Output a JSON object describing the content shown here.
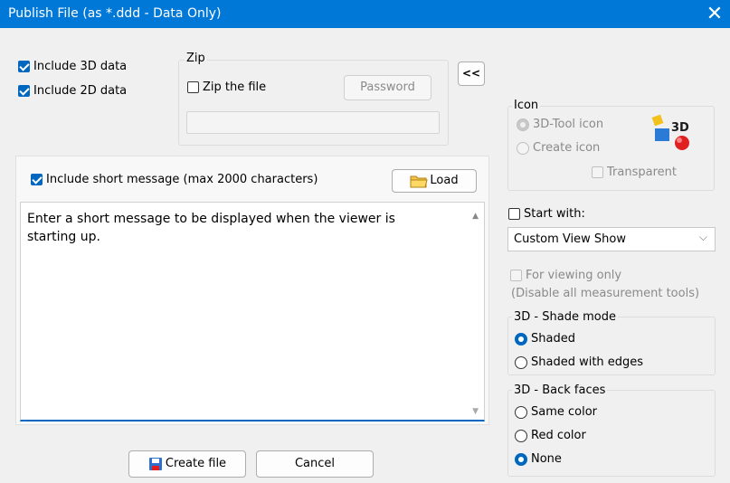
{
  "window": {
    "title": "Publish File (as *.ddd - Data Only)"
  },
  "options": {
    "include_3d": "Include 3D data",
    "include_2d": "Include 2D data"
  },
  "zip": {
    "group_title": "Zip",
    "zip_label": "Zip the file",
    "password_label": "Password"
  },
  "collapse_label": "<<",
  "message": {
    "include_label": "Include short message (max 2000 characters)",
    "load_label": "Load",
    "text": "Enter a short message to be displayed when the viewer is starting up."
  },
  "icon": {
    "group_title": "Icon",
    "tool_icon": "3D-Tool icon",
    "create_icon": "Create icon",
    "transparent": "Transparent",
    "badge": "3D"
  },
  "start": {
    "label": "Start with:",
    "selected": "Custom View Show"
  },
  "viewing": {
    "label": "For viewing only",
    "sublabel": "(Disable all measurement tools)"
  },
  "shade_mode": {
    "title": "3D - Shade mode",
    "options": [
      "Shaded",
      "Shaded with edges"
    ]
  },
  "back_faces": {
    "title": "3D - Back faces",
    "options": [
      "Same color",
      "Red color",
      "None"
    ]
  },
  "footer": {
    "create": "Create file",
    "cancel": "Cancel"
  },
  "colors": {
    "titlebar": "#0078d7",
    "accent": "#0067c0"
  }
}
